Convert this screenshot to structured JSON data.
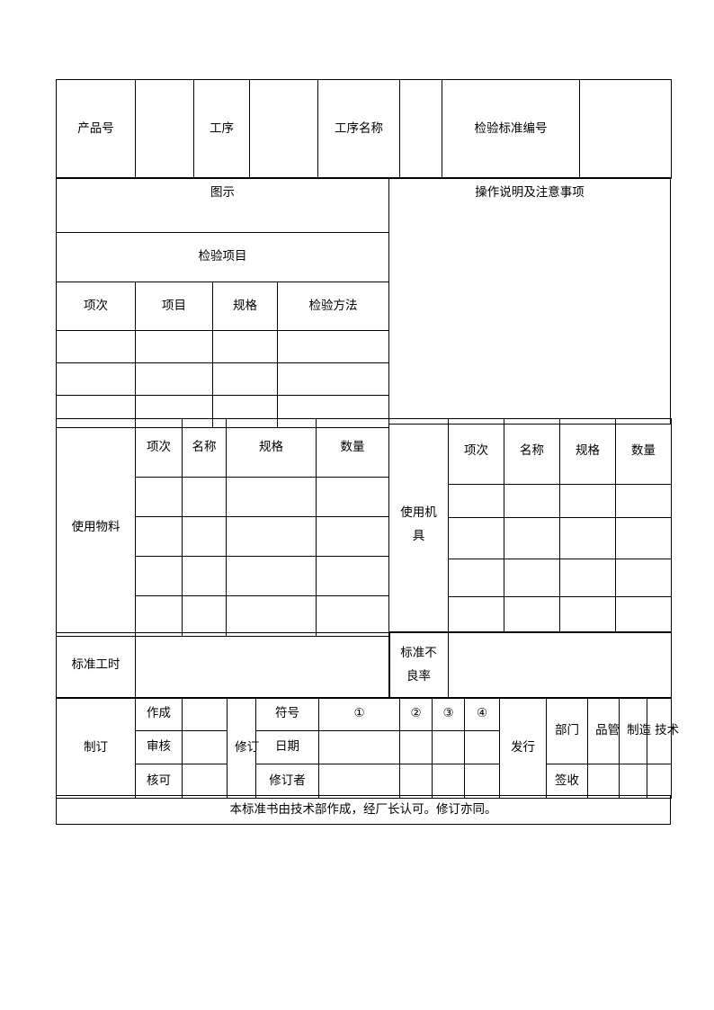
{
  "document": {
    "type": "inspection-standard-form",
    "language": "zh-CN"
  },
  "header_row": {
    "product_no_label": "产品号",
    "product_no_value": "",
    "process_label": "工序",
    "process_value": "",
    "process_name_label": "工序名称",
    "process_name_value": "",
    "standard_no_label": "检验标准编号",
    "standard_no_value": ""
  },
  "diagram": {
    "label": "图示",
    "content": ""
  },
  "operation": {
    "label": "操作说明及注意事项",
    "content": ""
  },
  "inspection": {
    "section_title": "检验项目",
    "columns": [
      "项次",
      "项目",
      "规格",
      "检验方法"
    ],
    "rows": [
      [
        "",
        "",
        "",
        ""
      ],
      [
        "",
        "",
        "",
        ""
      ],
      [
        "",
        "",
        "",
        ""
      ]
    ]
  },
  "materials": {
    "label": "使用物料",
    "columns": [
      "项次",
      "名称",
      "规格",
      "数量"
    ],
    "rows": [
      [
        "",
        "",
        "",
        ""
      ],
      [
        "",
        "",
        "",
        ""
      ],
      [
        "",
        "",
        "",
        ""
      ],
      [
        "",
        "",
        "",
        ""
      ]
    ]
  },
  "tools": {
    "label": "使用机具",
    "label_line1": "使用机",
    "label_line2": "具",
    "columns": [
      "项次",
      "名称",
      "规格",
      "数量"
    ],
    "rows": [
      [
        "",
        "",
        "",
        ""
      ],
      [
        "",
        "",
        "",
        ""
      ],
      [
        "",
        "",
        "",
        ""
      ],
      [
        "",
        "",
        "",
        ""
      ]
    ]
  },
  "standard_time": {
    "label": "标准工时",
    "value": ""
  },
  "defect_rate": {
    "label": "标准不良率",
    "label_line1": "标准不",
    "label_line2": "良率",
    "value": ""
  },
  "signature": {
    "draft_label": "制订",
    "roles": [
      {
        "label": "作成",
        "value": ""
      },
      {
        "label": "审核",
        "value": ""
      },
      {
        "label": "核可",
        "value": ""
      }
    ],
    "revision_label": "修订",
    "revision_rows": [
      {
        "label": "符号",
        "values": [
          "①",
          "②",
          "③",
          "④"
        ]
      },
      {
        "label": "日期",
        "values": [
          "",
          "",
          "",
          ""
        ]
      },
      {
        "label": "修订者",
        "values": [
          "",
          "",
          "",
          ""
        ]
      }
    ],
    "issue_label": "发行",
    "dept_label": "部门",
    "receipt_label": "签收",
    "departments": [
      {
        "label": "品管",
        "value": ""
      },
      {
        "label": "制造",
        "value": ""
      },
      {
        "label": "技术",
        "value": ""
      }
    ]
  },
  "footer_note": {
    "text": "本标准书由技术部作成，经厂长认可。修订亦同。"
  },
  "colors": {
    "line": "#000000",
    "background": "#ffffff",
    "text": "#000000"
  }
}
